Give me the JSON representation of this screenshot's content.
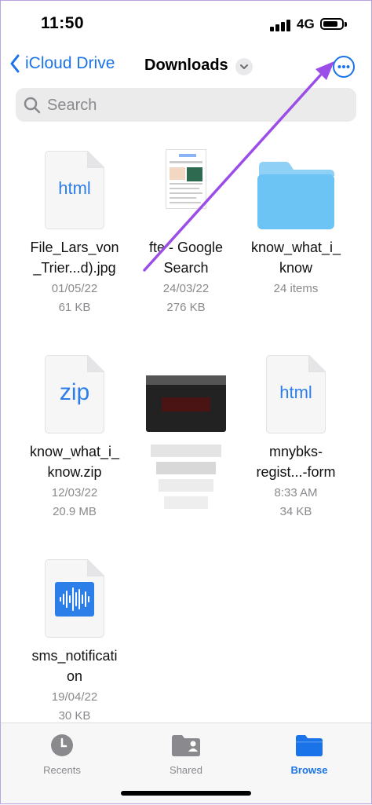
{
  "status": {
    "time": "11:50",
    "network": "4G"
  },
  "nav": {
    "back_label": "iCloud Drive",
    "title": "Downloads"
  },
  "search": {
    "placeholder": "Search"
  },
  "items": [
    {
      "name1": "File_Lars_von",
      "name2": "_Trier...d).jpg",
      "meta1": "01/05/22",
      "meta2": "61 KB",
      "ext": "html"
    },
    {
      "name1": "fte - Google",
      "name2": "Search",
      "meta1": "24/03/22",
      "meta2": "276 KB"
    },
    {
      "name1": "know_what_i_",
      "name2": "know",
      "meta1": "24 items",
      "meta2": ""
    },
    {
      "name1": "know_what_i_",
      "name2": "know.zip",
      "meta1": "12/03/22",
      "meta2": "20.9 MB",
      "ext": "zip"
    },
    {
      "name1": "",
      "name2": "",
      "meta1": "",
      "meta2": ""
    },
    {
      "name1": "mnybks-",
      "name2": "regist...-form",
      "meta1": "8:33 AM",
      "meta2": "34 KB",
      "ext": "html"
    },
    {
      "name1": "sms_notificati",
      "name2": "on",
      "meta1": "19/04/22",
      "meta2": "30 KB"
    }
  ],
  "tabs": [
    {
      "label": "Recents",
      "icon": "clock-icon"
    },
    {
      "label": "Shared",
      "icon": "shared-folder-icon"
    },
    {
      "label": "Browse",
      "icon": "folder-icon"
    }
  ],
  "colors": {
    "accent": "#1a73e8",
    "annotation_arrow": "#9b4dea",
    "folder": "#6cc4f5"
  }
}
